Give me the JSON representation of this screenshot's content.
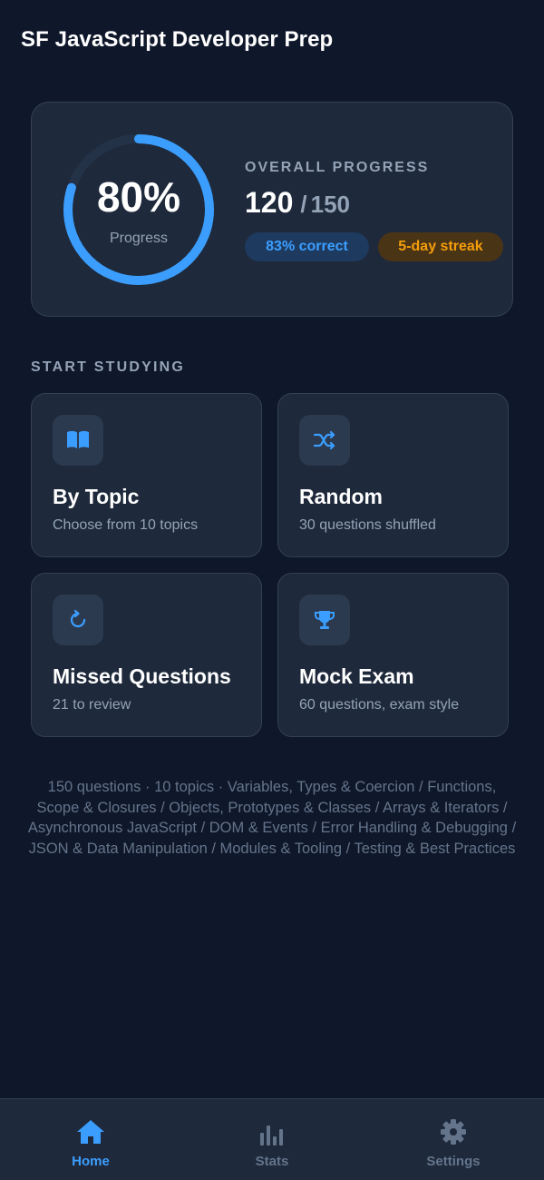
{
  "app": {
    "title": "SF JavaScript Developer Prep"
  },
  "progress": {
    "percent_text": "80%",
    "percent_value": 0.8,
    "ring_label": "Progress",
    "overall_label": "OVERALL PROGRESS",
    "answered": "120",
    "separator": "/",
    "total": "150",
    "correct_badge": "83% correct",
    "streak_badge": "5-day streak"
  },
  "study": {
    "heading": "START STUDYING",
    "modes": [
      {
        "title": "By Topic",
        "subtitle": "Choose from 10 topics",
        "icon": "book-icon"
      },
      {
        "title": "Random",
        "subtitle": "30 questions shuffled",
        "icon": "shuffle-icon"
      },
      {
        "title": "Missed Questions",
        "subtitle": "21 to review",
        "icon": "refresh-icon"
      },
      {
        "title": "Mock Exam",
        "subtitle": "60 questions, exam style",
        "icon": "trophy-icon"
      }
    ]
  },
  "summary": "150 questions · 10 topics · Variables, Types & Coercion / Functions, Scope & Closures / Objects, Prototypes & Classes / Arrays & Iterators / Asynchronous JavaScript / DOM & Events / Error Handling & Debugging / JSON & Data Manipulation / Modules & Tooling / Testing & Best Practices",
  "tabs": [
    {
      "label": "Home",
      "icon": "home-icon",
      "active": true
    },
    {
      "label": "Stats",
      "icon": "bar-chart-icon",
      "active": false
    },
    {
      "label": "Settings",
      "icon": "gear-icon",
      "active": false
    }
  ],
  "colors": {
    "background": "#0f172a",
    "card": "#1e293b",
    "accent_blue": "#3b9eff",
    "accent_orange": "#f59e0b",
    "muted": "#94a3b8"
  }
}
